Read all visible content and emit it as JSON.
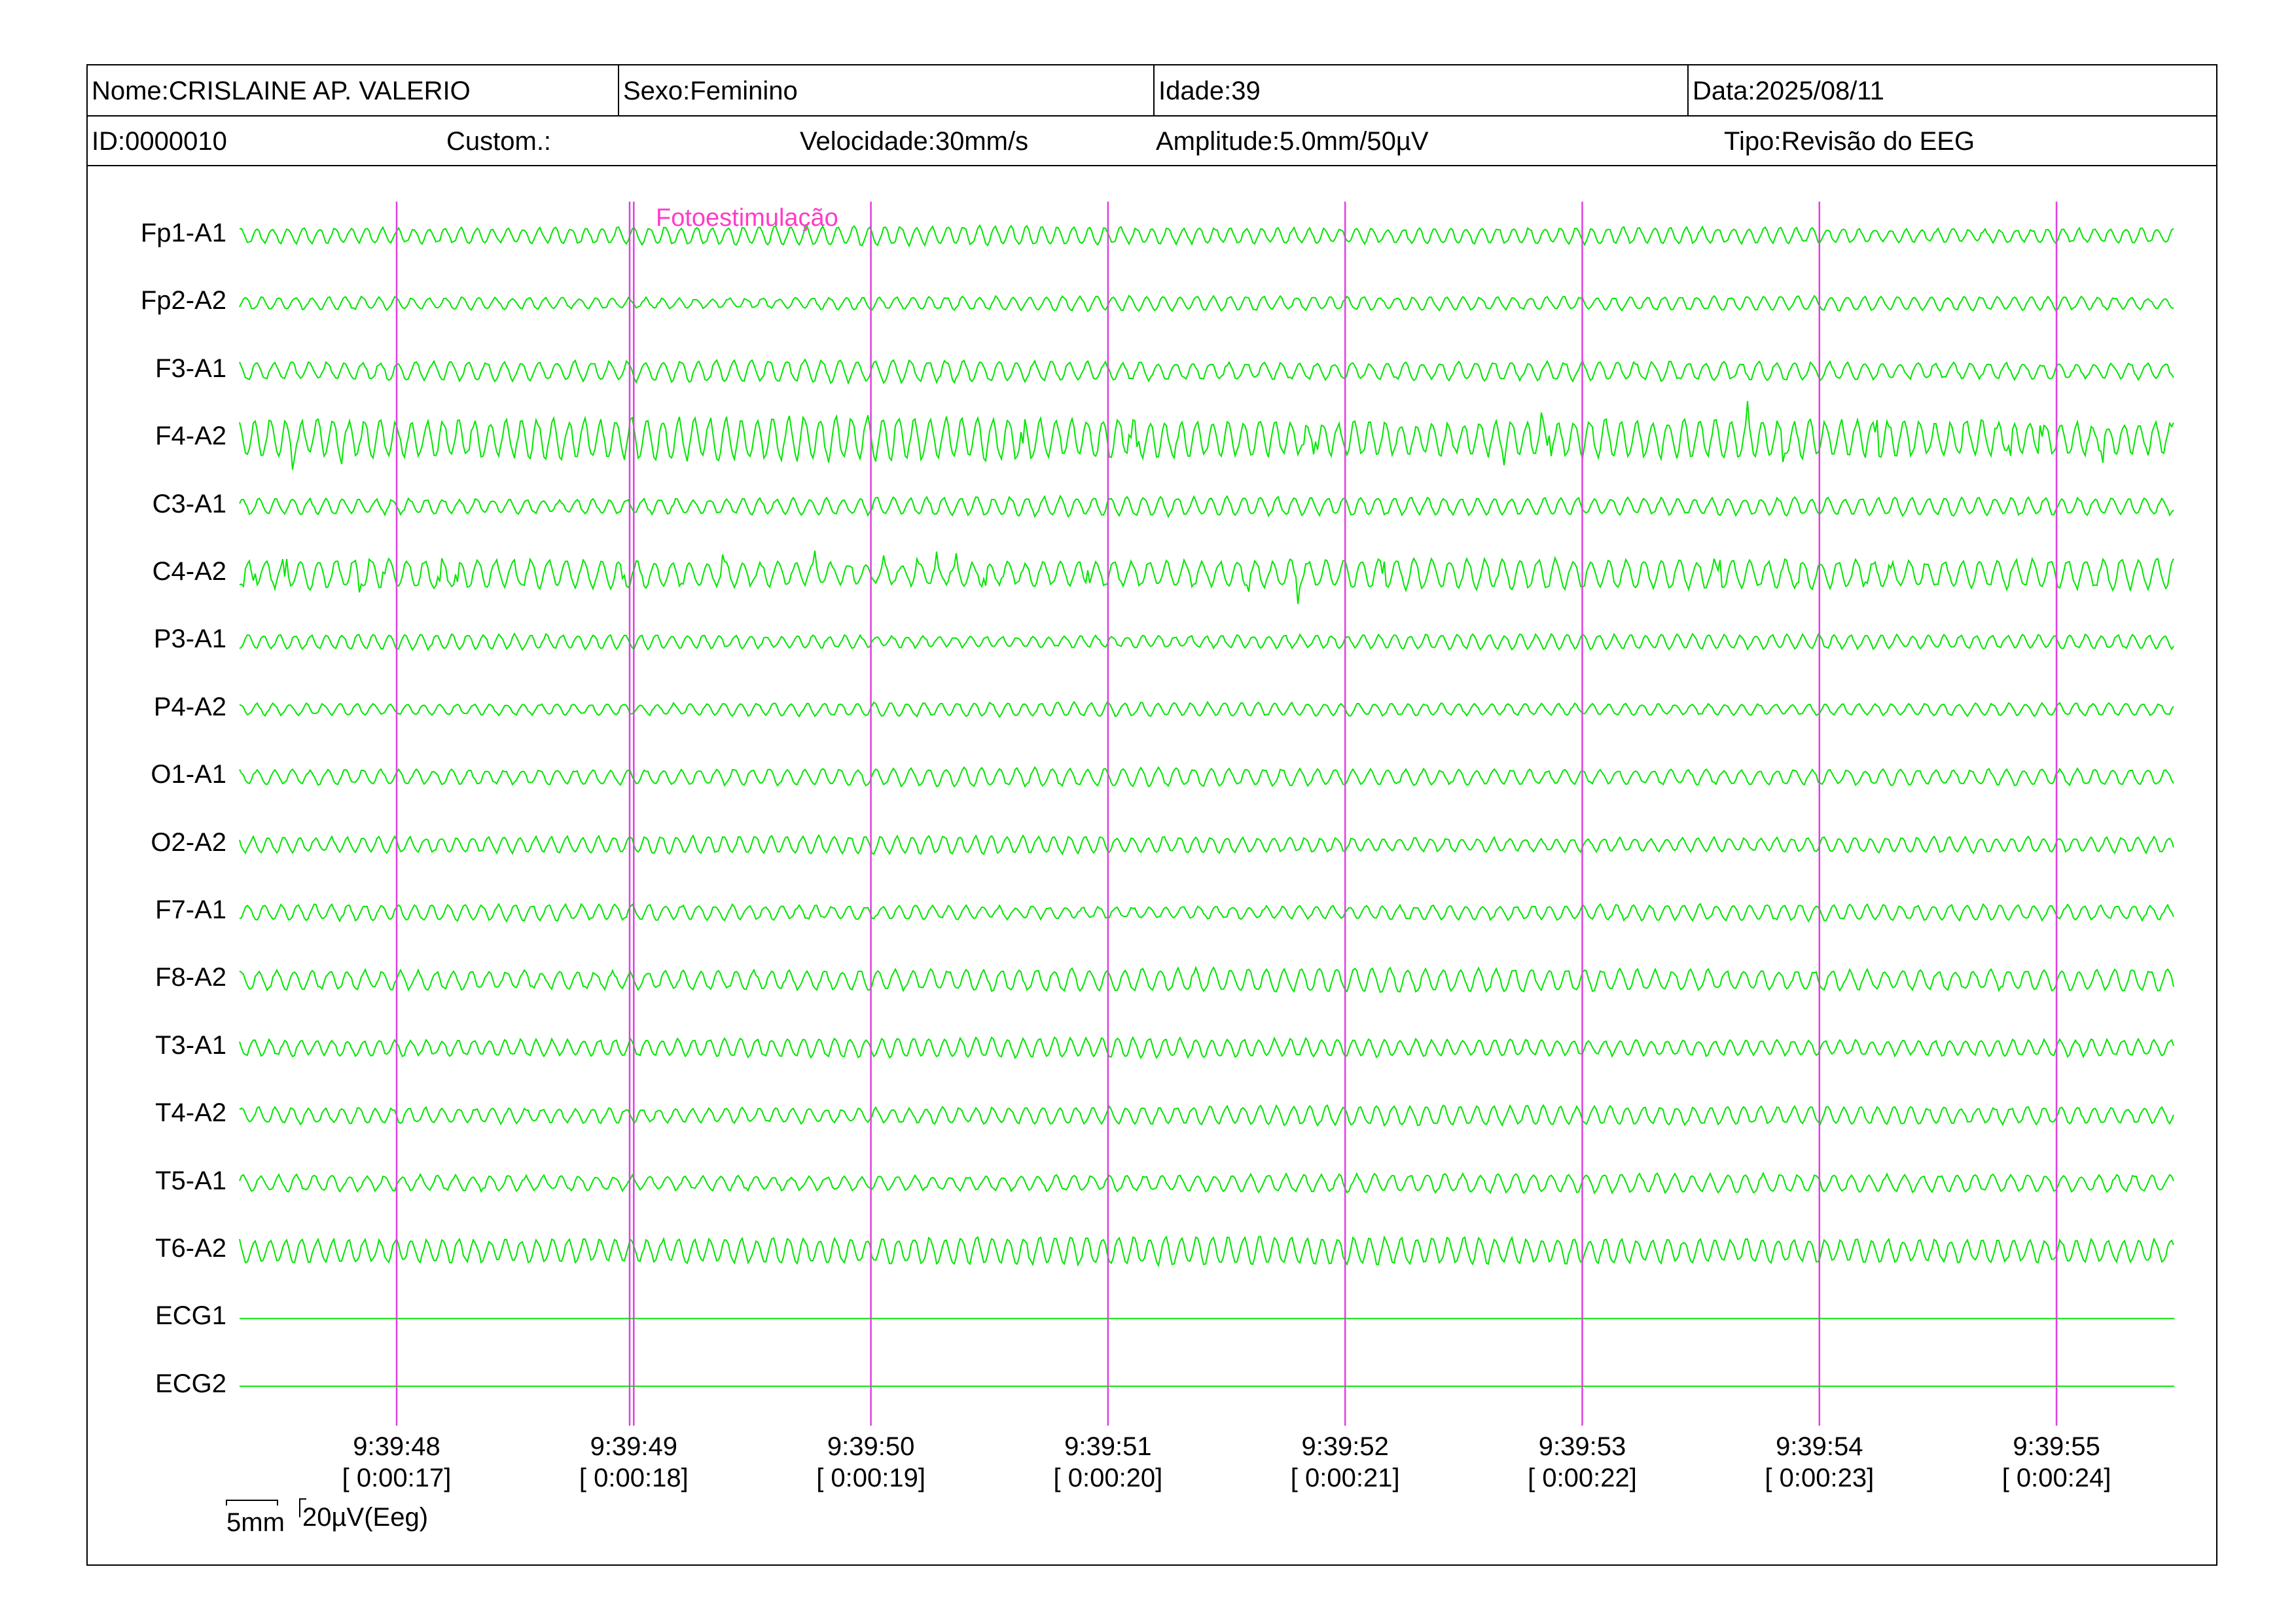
{
  "header": {
    "name": "Nome:CRISLAINE AP. VALERIO",
    "sex": "Sexo:Feminino",
    "age": "Idade:39",
    "date": "Data:2025/08/11",
    "id": "ID:0000010",
    "custom": "Custom.:",
    "speed": "Velocidade:30mm/s",
    "amplitude": "Amplitude:5.0mm/50µV",
    "type": "Tipo:Revisão do EEG"
  },
  "event": {
    "label": "Fotoestimulação"
  },
  "channels": [
    {
      "label": "Fp1-A1",
      "kind": "eeg"
    },
    {
      "label": "Fp2-A2",
      "kind": "eeg"
    },
    {
      "label": "F3-A1",
      "kind": "eeg"
    },
    {
      "label": "F4-A2",
      "kind": "eeg"
    },
    {
      "label": "C3-A1",
      "kind": "eeg"
    },
    {
      "label": "C4-A2",
      "kind": "eeg"
    },
    {
      "label": "P3-A1",
      "kind": "eeg"
    },
    {
      "label": "P4-A2",
      "kind": "eeg"
    },
    {
      "label": "O1-A1",
      "kind": "eeg"
    },
    {
      "label": "O2-A2",
      "kind": "eeg"
    },
    {
      "label": "F7-A1",
      "kind": "eeg"
    },
    {
      "label": "F8-A2",
      "kind": "eeg"
    },
    {
      "label": "T3-A1",
      "kind": "eeg"
    },
    {
      "label": "T4-A2",
      "kind": "eeg"
    },
    {
      "label": "T5-A1",
      "kind": "eeg"
    },
    {
      "label": "T6-A2",
      "kind": "eeg"
    },
    {
      "label": "ECG1",
      "kind": "flat"
    },
    {
      "label": "ECG2",
      "kind": "flat"
    }
  ],
  "time_marks": [
    {
      "clock": "9:39:48",
      "elapsed": "[ 0:00:17]"
    },
    {
      "clock": "9:39:49",
      "elapsed": "[ 0:00:18]"
    },
    {
      "clock": "9:39:50",
      "elapsed": "[ 0:00:19]"
    },
    {
      "clock": "9:39:51",
      "elapsed": "[ 0:00:20]"
    },
    {
      "clock": "9:39:52",
      "elapsed": "[ 0:00:21]"
    },
    {
      "clock": "9:39:53",
      "elapsed": "[ 0:00:22]"
    },
    {
      "clock": "9:39:54",
      "elapsed": "[ 0:00:23]"
    },
    {
      "clock": "9:39:55",
      "elapsed": "[ 0:00:24]"
    }
  ],
  "scale": {
    "time_label": "5mm",
    "amplitude_label": "20µV(Eeg)"
  },
  "colors": {
    "trace": "#00e600",
    "marker": "#e040e0",
    "event_text": "#ff3cc8",
    "border": "#000000"
  }
}
